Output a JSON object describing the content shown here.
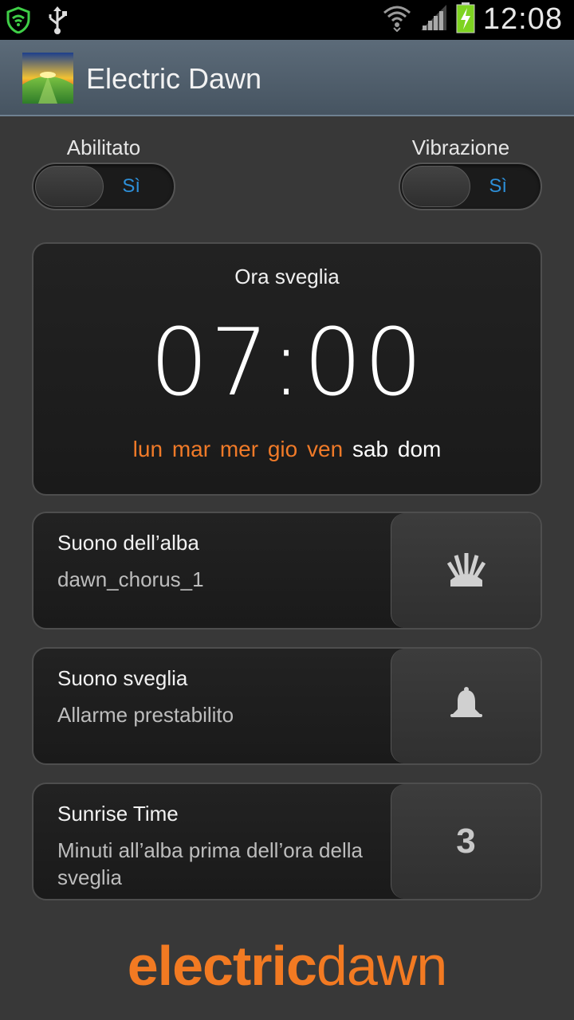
{
  "status_bar": {
    "time": "12:08",
    "icons": [
      "shield-wifi-icon",
      "usb-icon",
      "wifi-icon",
      "signal-icon",
      "battery-charging-icon"
    ]
  },
  "action_bar": {
    "title": "Electric Dawn",
    "icon": "app-sunrise-icon"
  },
  "toggles": {
    "enabled": {
      "label": "Abilitato",
      "state_text": "Sì"
    },
    "vibration": {
      "label": "Vibrazione",
      "state_text": "Sì"
    }
  },
  "alarm": {
    "title": "Ora sveglia",
    "time": "07:00",
    "days_active": [
      "lun",
      "mar",
      "mer",
      "gio",
      "ven"
    ],
    "days_inactive": [
      "sab",
      "dom"
    ],
    "colors": {
      "active": "#f07a28",
      "inactive": "#ffffff"
    }
  },
  "settings": [
    {
      "title": "Suono dell’alba",
      "subtitle": "dawn_chorus_1",
      "action_icon": "sunrise-icon"
    },
    {
      "title": "Suono sveglia",
      "subtitle": "Allarme prestabilito",
      "action_icon": "bell-icon"
    },
    {
      "title": "Sunrise Time",
      "subtitle": "Minuti all’alba prima dell’ora della sveglia",
      "action_value": "3"
    }
  ],
  "logo": {
    "bold": "electric",
    "light": "dawn",
    "color": "#f27a22"
  }
}
